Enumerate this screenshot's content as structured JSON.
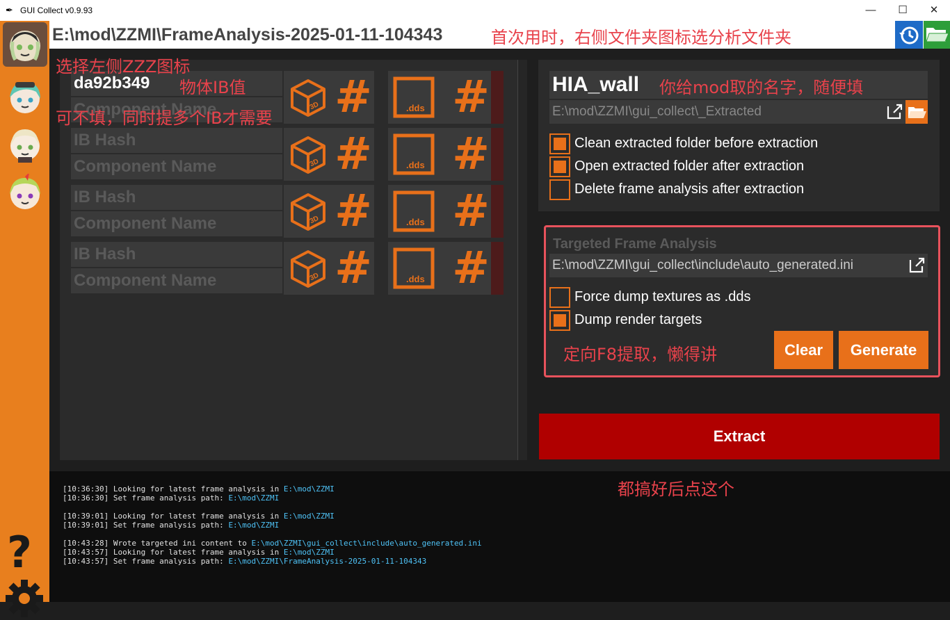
{
  "window": {
    "title": "GUI Collect v0.9.93",
    "controls": [
      "—",
      "☐",
      "✕"
    ]
  },
  "pathbar": {
    "path": "E:\\mod\\ZZMI\\FrameAnalysis-2025-01-11-104343"
  },
  "annotations": {
    "top": "首次用时，右侧文件夹图标选分析文件夹",
    "left_icon": "选择左侧ZZZ图标",
    "ib_value": "物体IB值",
    "optional": "可不填，同时提多个IB才需要",
    "mod_name": "你给mod取的名字，随便填",
    "targeted": "定向F8提取，懒得讲",
    "extract": "都搞好后点这个"
  },
  "sidebar": {
    "help": "?"
  },
  "components": [
    {
      "ib_hash": "da92b349",
      "ib_placeholder": "IB Hash",
      "component_placeholder": "Component Name"
    },
    {
      "ib_hash": "",
      "ib_placeholder": "IB Hash",
      "component_placeholder": "Component Name"
    },
    {
      "ib_hash": "",
      "ib_placeholder": "IB Hash",
      "component_placeholder": "Component Name"
    },
    {
      "ib_hash": "",
      "ib_placeholder": "IB Hash",
      "component_placeholder": "Component Name"
    }
  ],
  "tile_labels": {
    "three_d": "3D",
    "dds": ".dds",
    "hash": "#"
  },
  "extraction": {
    "mod_name": "HIA_wall",
    "output_path": "E:\\mod\\ZZMI\\gui_collect\\_Extracted",
    "options": [
      {
        "label": "Clean extracted folder before extraction",
        "checked": true
      },
      {
        "label": "Open extracted folder after extraction",
        "checked": true
      },
      {
        "label": "Delete frame analysis after extraction",
        "checked": false
      }
    ]
  },
  "targeted": {
    "title": "Targeted Frame Analysis",
    "ini_path": "E:\\mod\\ZZMI\\gui_collect\\include\\auto_generated.ini",
    "options": [
      {
        "label": "Force dump textures as .dds",
        "checked": false
      },
      {
        "label": "Dump render targets",
        "checked": true
      }
    ],
    "clear_label": "Clear",
    "generate_label": "Generate"
  },
  "extract_label": "Extract",
  "log": [
    {
      "time": "[10:36:30]",
      "msg": "Looking for latest frame analysis in ",
      "path": "E:\\mod\\ZZMI"
    },
    {
      "time": "[10:36:30]",
      "msg": "Set frame analysis path: ",
      "path": "E:\\mod\\ZZMI"
    },
    {
      "time": "[10:39:01]",
      "msg": "Looking for latest frame analysis in ",
      "path": "E:\\mod\\ZZMI"
    },
    {
      "time": "[10:39:01]",
      "msg": "Set frame analysis path: ",
      "path": "E:\\mod\\ZZMI"
    },
    {
      "time": "[10:43:28]",
      "msg": "Wrote targeted ini content to ",
      "path": "E:\\mod\\ZZMI\\gui_collect\\include\\auto_generated.ini"
    },
    {
      "time": "[10:43:57]",
      "msg": "Looking for latest frame analysis in ",
      "path": "E:\\mod\\ZZMI"
    },
    {
      "time": "[10:43:57]",
      "msg": "Set frame analysis path: ",
      "path": "E:\\mod\\ZZMI\\FrameAnalysis-2025-01-11-104343"
    }
  ],
  "colors": {
    "accent": "#e8701a",
    "extract": "#b00000",
    "annotation": "#e8424b",
    "history_btn": "#1e6bc7",
    "folder_btn": "#2e9e3a"
  }
}
